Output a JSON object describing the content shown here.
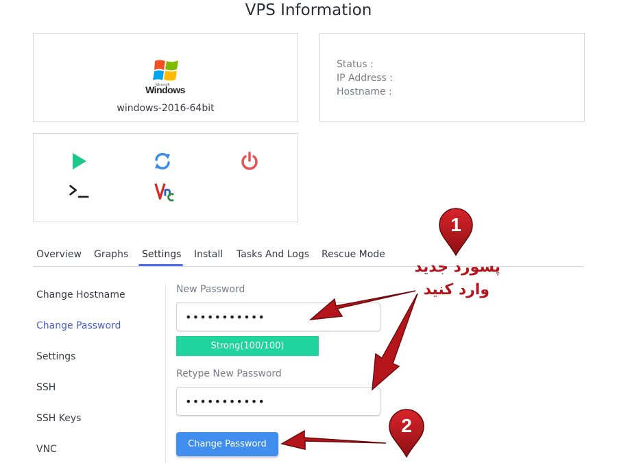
{
  "page": {
    "title": "VPS Information"
  },
  "os": {
    "brand": "Windows",
    "brand_small": "Microsoft",
    "name": "windows-2016-64bit"
  },
  "info": {
    "status_label": "Status :",
    "ip_label": "IP Address :",
    "hostname_label": "Hostname :"
  },
  "actions": [
    {
      "name": "play-icon",
      "color": "#1cc88a"
    },
    {
      "name": "refresh-icon",
      "color": "#3b8fe8"
    },
    {
      "name": "power-icon",
      "color": "#e55353"
    },
    {
      "name": "console-icon",
      "color": "#1a1a1a"
    },
    {
      "name": "vnc-icon",
      "color": "#d62828"
    }
  ],
  "tabs": [
    "Overview",
    "Graphs",
    "Settings",
    "Install",
    "Tasks And Logs",
    "Rescue Mode"
  ],
  "active_tab": "Settings",
  "sidebar": [
    "Change Hostname",
    "Change Password",
    "Settings",
    "SSH",
    "SSH Keys",
    "VNC"
  ],
  "active_sidebar": "Change Password",
  "form": {
    "new_password_label": "New Password",
    "new_password_value": "•••••••••••",
    "strength_text": "Strong(100/100)",
    "strength": {
      "score": 100,
      "max": 100
    },
    "retype_label": "Retype New Password",
    "retype_value": "•••••••••••",
    "submit_label": "Change Password"
  },
  "annotations": {
    "pin1_number": "1",
    "pin2_number": "2",
    "note_line1": "پسورد جدید",
    "note_line2": "وارد کنید",
    "color": "#b5151a"
  },
  "colors": {
    "accent": "#4a6cf7",
    "strength": "#1fd49d",
    "button": "#3f8ef0"
  }
}
